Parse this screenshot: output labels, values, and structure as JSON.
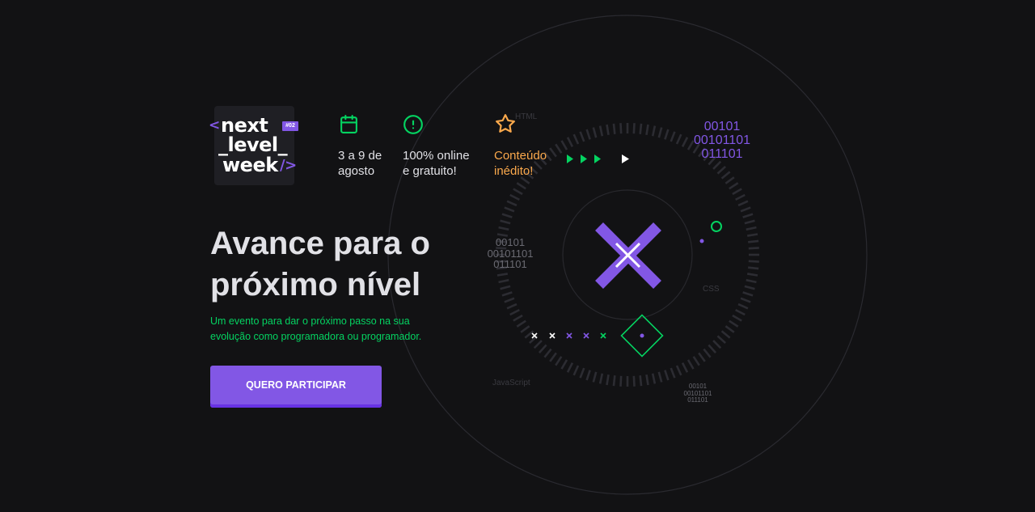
{
  "logo": {
    "line1": "next",
    "line2": "_level_",
    "line3": "week",
    "left_bracket": "<",
    "right_bracket": "/>",
    "badge": "#02"
  },
  "features": [
    {
      "icon": "calendar-icon",
      "line1": "3 a 9 de",
      "line2": "agosto",
      "color": "#e1e1e6",
      "icon_color": "#04d361"
    },
    {
      "icon": "alert-circle-icon",
      "line1": "100% online",
      "line2": "e gratuito!",
      "color": "#e1e1e6",
      "icon_color": "#04d361"
    },
    {
      "icon": "star-icon",
      "line1": "Conteúdo",
      "line2": "inédito!",
      "color": "#fba94c",
      "icon_color": "#fba94c"
    }
  ],
  "hero": {
    "title_line1": "Avance para o",
    "title_line2": "próximo nível",
    "subtitle": "Um evento para dar o próximo passo na sua evolução como programadora ou programador.",
    "cta_label": "QUERO PARTICIPAR"
  },
  "decor": {
    "html_label": "HTML",
    "css_label": "CSS",
    "js_label": "JavaScript",
    "binary_top": [
      "00101",
      "00101101",
      "011101"
    ],
    "binary_mid": [
      "00101",
      "00101101",
      "011101"
    ],
    "binary_bottom": [
      "00101",
      "00101101",
      "011101"
    ]
  },
  "colors": {
    "background": "#121214",
    "purple": "#8257e5",
    "green": "#04d361",
    "yellow": "#fba94c",
    "text": "#e1e1e6"
  }
}
